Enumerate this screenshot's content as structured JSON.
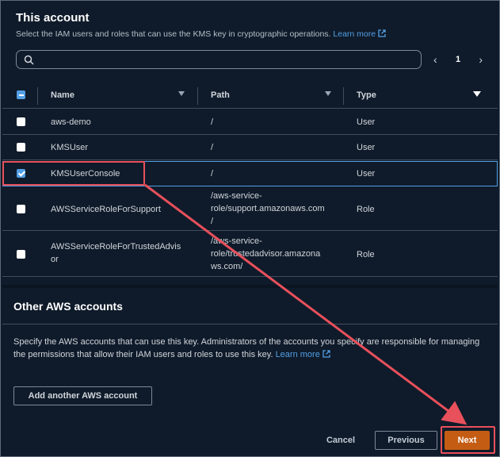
{
  "section": {
    "title": "This account",
    "description": "Select the IAM users and roles that can use the KMS key in cryptographic operations.",
    "learn_more": "Learn more"
  },
  "search": {
    "placeholder": "",
    "value": ""
  },
  "pagination": {
    "current_page": "1",
    "prev": "‹",
    "next": "›"
  },
  "table": {
    "columns": [
      "Name",
      "Path",
      "Type"
    ],
    "rows": [
      {
        "name": "aws-demo",
        "path": "/",
        "type": "User",
        "checked": false
      },
      {
        "name": "KMSUser",
        "path": "/",
        "type": "User",
        "checked": false
      },
      {
        "name": "KMSUserConsole",
        "path": "/",
        "type": "User",
        "checked": true
      },
      {
        "name": "AWSServiceRoleForSupport",
        "path": "/aws-service-role/support.amazonaws.com/",
        "path_lines": [
          "/aws-service-",
          "role/support.amazonaws.com",
          "/"
        ],
        "type": "Role",
        "checked": false
      },
      {
        "name": "AWSServiceRoleForTrustedAdvisor",
        "name_lines": [
          "AWSServiceRoleForTrustedAdvis",
          "or"
        ],
        "path": "/aws-service-role/trustedadvisor.amazonaws.com/",
        "path_lines": [
          "/aws-service-",
          "role/trustedadvisor.amazona",
          "ws.com/"
        ],
        "type": "Role",
        "checked": false
      }
    ]
  },
  "other_accounts": {
    "title": "Other AWS accounts",
    "description": "Specify the AWS accounts that can use this key. Administrators of the accounts you specify are responsible for managing the permissions that allow their IAM users and roles to use this key.",
    "learn_more": "Learn more",
    "add_button": "Add another AWS account"
  },
  "footer": {
    "cancel": "Cancel",
    "previous": "Previous",
    "next": "Next"
  },
  "colors": {
    "background": "#0f1b2a",
    "link": "#539fe5",
    "primary_button": "#c45c13",
    "annotation": "#e8505b"
  }
}
